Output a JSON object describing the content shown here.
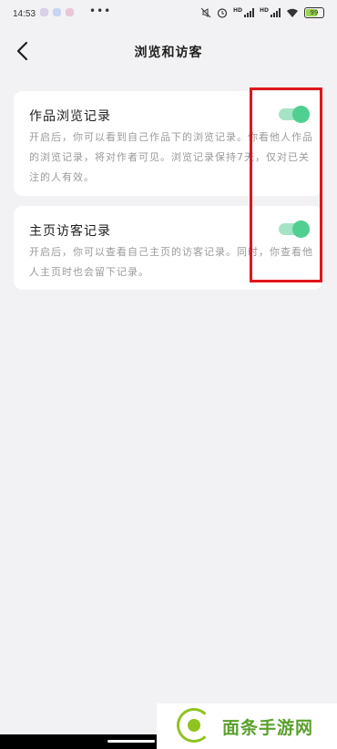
{
  "status_bar": {
    "time": "14:53",
    "more": "•••",
    "battery": "99",
    "signal1_label": "HD",
    "signal2_label": "HD"
  },
  "header": {
    "title": "浏览和访客"
  },
  "settings": [
    {
      "title": "作品浏览记录",
      "description": "开启后，你可以看到自己作品下的浏览记录。你看他人作品的浏览记录，将对作者可见。浏览记录保持7天，仅对已关注的人有效。",
      "enabled": true
    },
    {
      "title": "主页访客记录",
      "description": "开启后，你可以查看自己主页的访客记录。同时，你查看他人主页时也会留下记录。",
      "enabled": true
    }
  ],
  "watermark": {
    "text": "面条手游网"
  },
  "colors": {
    "toggle_on": "#4fcf90",
    "highlight": "#e0161d",
    "background": "#f2f2f4"
  }
}
